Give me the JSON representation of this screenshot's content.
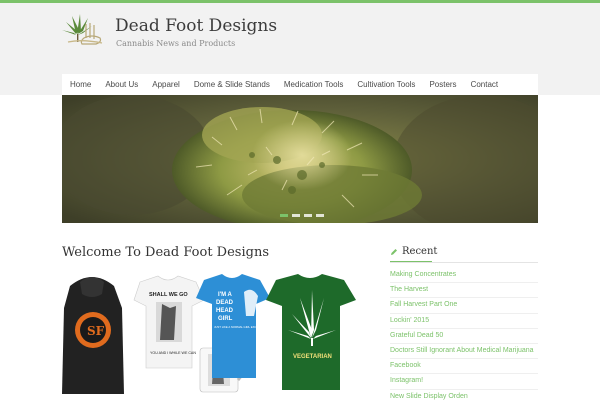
{
  "site": {
    "title": "Dead Foot Designs",
    "tagline": "Cannabis News and Products"
  },
  "nav": {
    "items": [
      "Home",
      "About Us",
      "Apparel",
      "Dome & Slide Stands",
      "Medication Tools",
      "Cultivation Tools",
      "Posters",
      "Contact"
    ]
  },
  "slider": {
    "slide_count": 4,
    "active_index": 0
  },
  "main": {
    "heading": "Welcome To Dead Foot Designs",
    "shirts": {
      "shirt2_text_top": "SHALL WE GO",
      "shirt2_text_bottom": "YOU AND I WHILE WE CAN",
      "shirt3_text_lines": [
        "I'M A",
        "DEAD",
        "HEAD",
        "GIRL"
      ],
      "shirt3_small_text": "JUST LIKE A NORMAL GIRL EXCEPT MUCH COOLER",
      "shirt4_text": "VEGETARIAN"
    }
  },
  "sidebar": {
    "recent_title": "Recent",
    "recent_items": [
      "Making Concentrates",
      "The Harvest",
      "Fall Harvest Part One",
      "Lockin' 2015",
      "Grateful Dead 50",
      "Doctors Still Ignorant About Medical Marijuana",
      "Facebook",
      "Instagram!",
      "New Slide Display Orden"
    ]
  },
  "colors": {
    "accent": "#7cc26a",
    "header_bg": "#f2f2f2",
    "text": "#333333"
  },
  "icons": {
    "logo": "cannabis-leaf-logo-icon",
    "recent": "pencil-icon"
  }
}
